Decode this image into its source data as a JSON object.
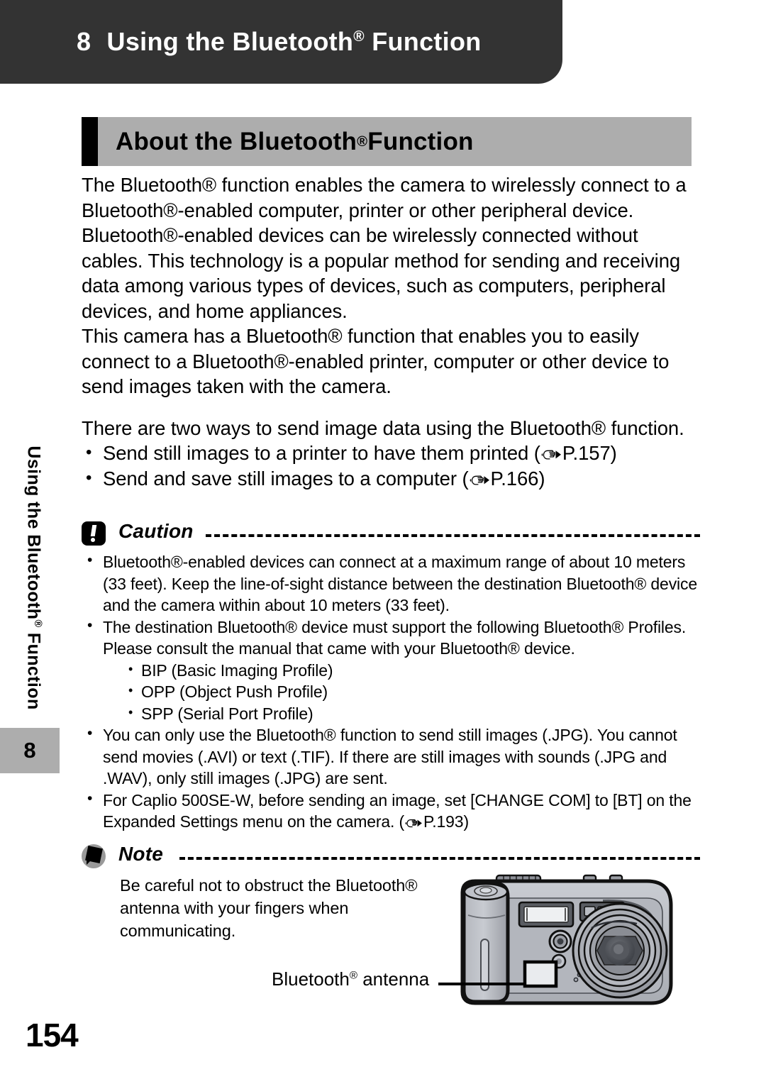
{
  "header": {
    "chapter_number": "8",
    "chapter_title_pre": "Using the Bluetooth",
    "chapter_title_post": " Function",
    "bar_color": "#333333"
  },
  "section": {
    "title_pre": "About the Bluetooth",
    "title_post": " Function",
    "bar_color": "#adadad",
    "tab_color": "#000000"
  },
  "sidebar": {
    "vertical_label_pre": "Using the Bluetooth",
    "vertical_label_post": " Function",
    "chapter_number": "8",
    "box_color": "#adadad"
  },
  "body": {
    "paragraph_1": "The Bluetooth® function enables the camera to wirelessly connect to a Bluetooth®-enabled computer, printer or other peripheral device. Bluetooth®-enabled devices can be wirelessly connected without cables. This technology is a popular method for sending and receiving data among various types of devices, such as computers, peripheral devices, and home appliances.",
    "paragraph_2": "This camera has a Bluetooth® function that enables you to easily connect to a Bluetooth®-enabled printer, computer or other device to send images taken with the camera.",
    "paragraph_3": "There are two ways to send image data using the Bluetooth® function.",
    "bullets": [
      {
        "text": "Send still images to a printer to have them printed (",
        "pageref": "P.157",
        "tail": ")"
      },
      {
        "text": "Send and save still images to a computer (",
        "pageref": "P.166",
        "tail": ")"
      }
    ]
  },
  "caution": {
    "title": "Caution",
    "icon": "caution-icon",
    "items": [
      "Bluetooth®-enabled devices can connect at a maximum range of about 10 meters (33 feet). Keep the line-of-sight distance between the destination Bluetooth® device and the camera within about 10 meters (33 feet).",
      "The destination Bluetooth® device must support the following Bluetooth® Profiles. Please consult the manual that came with your Bluetooth® device.",
      "You can only use the Bluetooth® function to send still images (.JPG). You cannot send movies (.AVI) or text (.TIF). If there are still images with sounds (.JPG and .WAV), only still images (.JPG) are sent.",
      "For Caplio 500SE-W, before sending an image, set [CHANGE COM] to [BT] on the Expanded Settings menu on the camera. ("
    ],
    "item4_pageref": "P.193",
    "item4_tail": ")",
    "profiles": [
      "BIP (Basic Imaging Profile)",
      "OPP (Object Push Profile)",
      "SPP (Serial Port Profile)"
    ]
  },
  "note": {
    "title": "Note",
    "icon": "note-icon",
    "text": "Be careful not to obstruct the Bluetooth® antenna with your fingers when communicating."
  },
  "figure": {
    "callout_label_pre": "Bluetooth",
    "callout_label_post": " antenna",
    "alt": "front view of a digital camera with the Bluetooth antenna location highlighted"
  },
  "footer": {
    "page_number": "154"
  }
}
